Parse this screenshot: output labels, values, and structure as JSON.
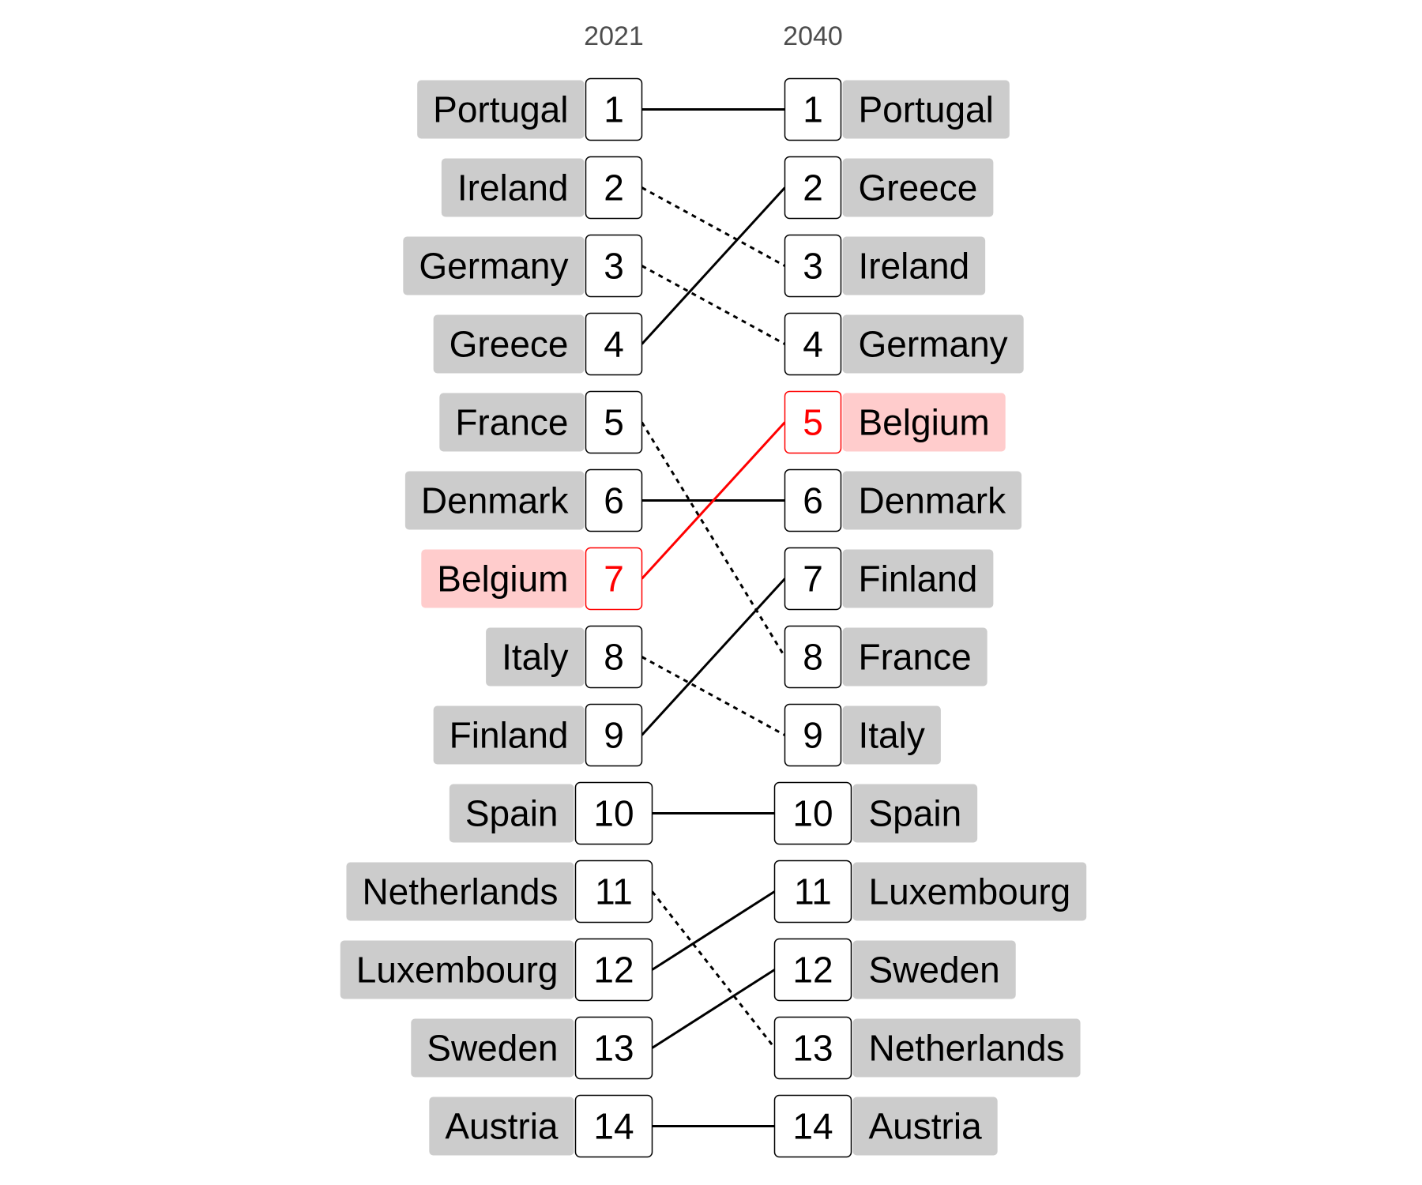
{
  "chart_data": {
    "type": "bump",
    "columns": [
      "2021",
      "2040"
    ],
    "ranking_2021": [
      "Portugal",
      "Ireland",
      "Germany",
      "Greece",
      "France",
      "Denmark",
      "Belgium",
      "Italy",
      "Finland",
      "Spain",
      "Netherlands",
      "Luxembourg",
      "Sweden",
      "Austria"
    ],
    "ranking_2040": [
      "Portugal",
      "Greece",
      "Ireland",
      "Germany",
      "Belgium",
      "Denmark",
      "Finland",
      "France",
      "Italy",
      "Spain",
      "Luxembourg",
      "Sweden",
      "Netherlands",
      "Austria"
    ],
    "highlight": "Belgium",
    "line_style": {
      "improved_or_same": "solid",
      "declined": "dashed"
    },
    "colors": {
      "label_bg": "#cccccc",
      "highlight_bg": "#ffcccc",
      "highlight": "#ff0000",
      "line": "#000000",
      "year_text": "#4d4d4d"
    }
  }
}
